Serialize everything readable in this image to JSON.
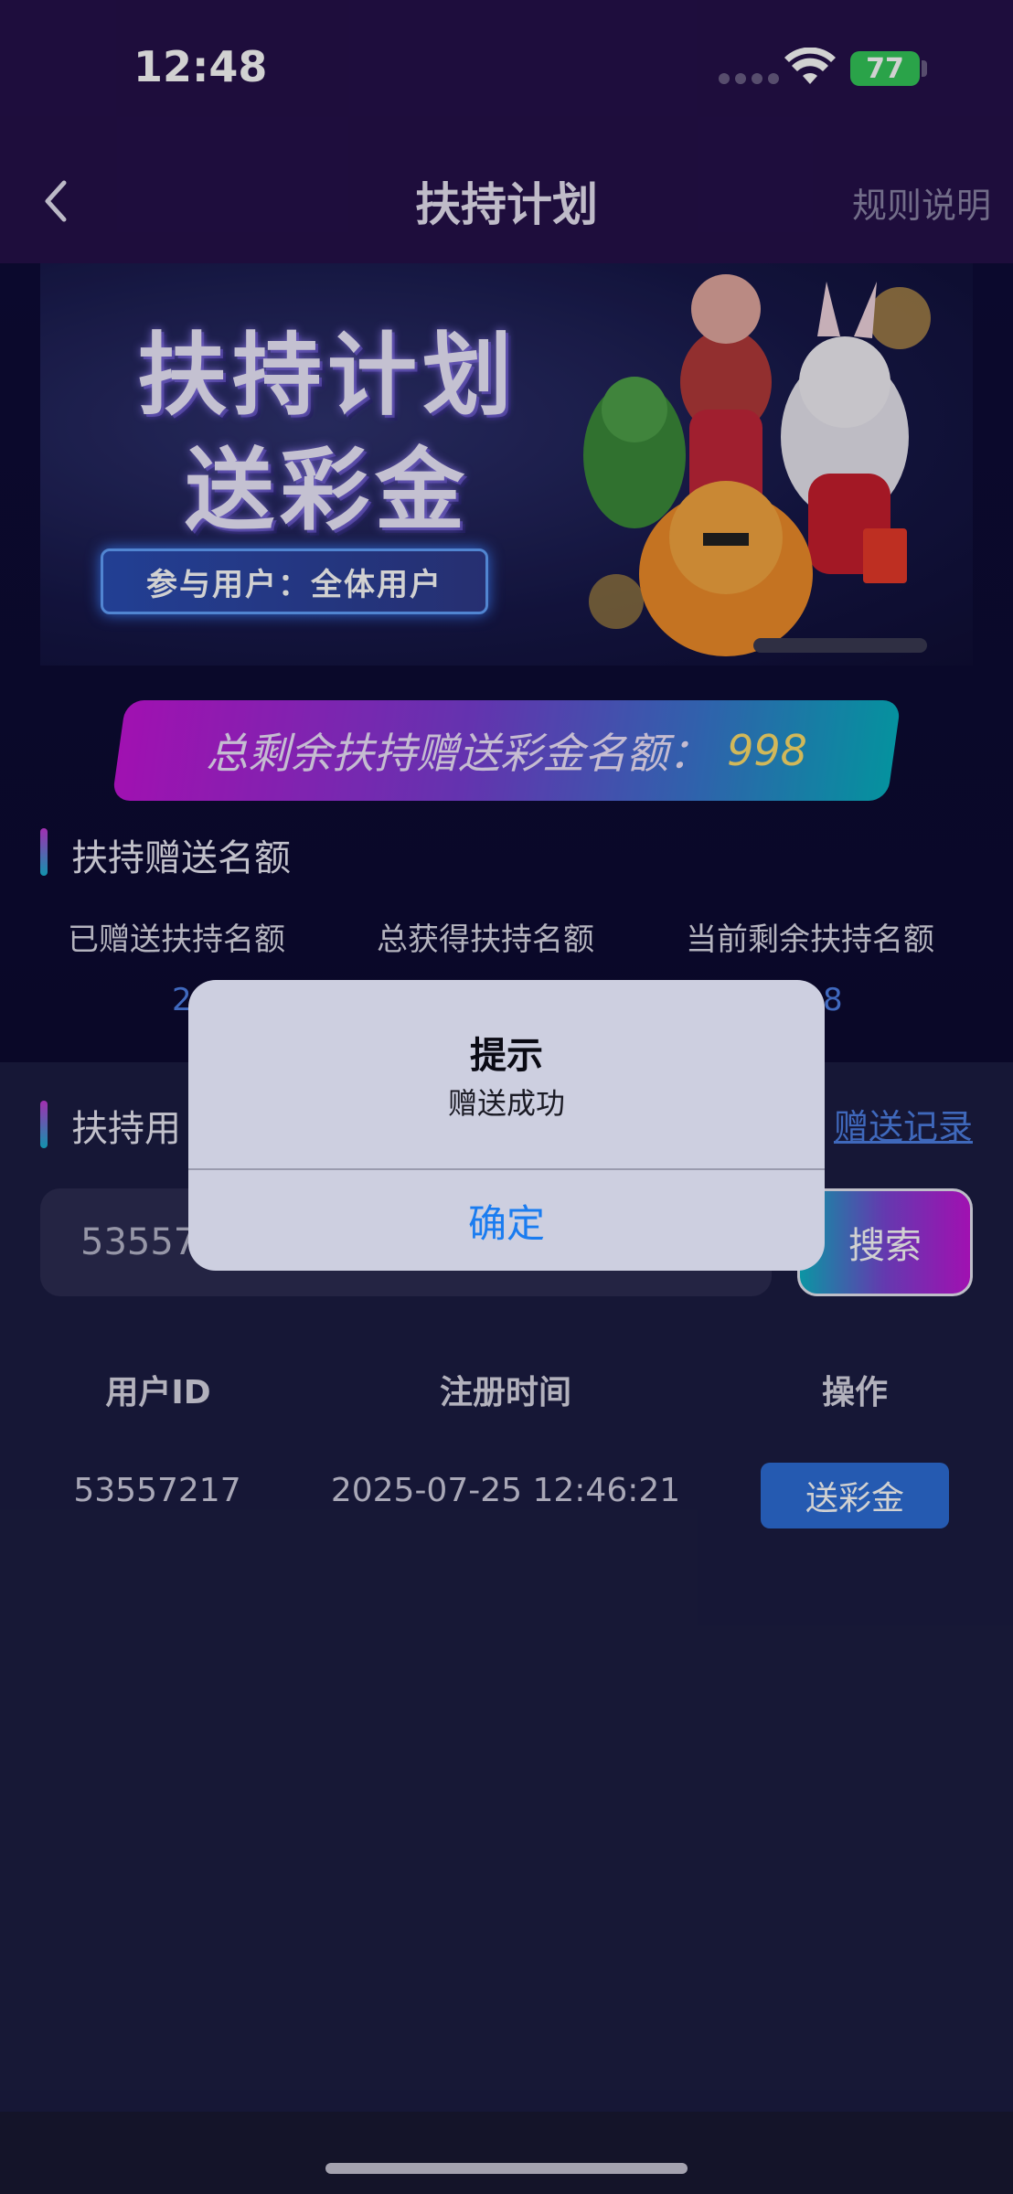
{
  "status_bar": {
    "time": "12:48",
    "battery": "77"
  },
  "nav": {
    "title": "扶持计划",
    "rules_label": "规则说明"
  },
  "banner": {
    "title_line1": "扶持计划",
    "title_line2": "送彩金",
    "tag": "参与用户：全体用户"
  },
  "quota": {
    "label": "总剩余扶持赠送彩金名额：",
    "value": "998"
  },
  "section1": {
    "title": "扶持赠送名额",
    "stats": [
      {
        "label": "已赠送扶持名额",
        "value": "2"
      },
      {
        "label": "总获得扶持名额",
        "value": ""
      },
      {
        "label": "当前剩余扶持名额",
        "value": "8"
      }
    ]
  },
  "section2": {
    "title_partial": "扶持用",
    "records_link": "赠送记录",
    "search_value": "53557",
    "search_button": "搜索"
  },
  "table": {
    "headers": [
      "用户ID",
      "注册时间",
      "操作"
    ],
    "rows": [
      {
        "user_id": "53557217",
        "reg_time": "2025-07-25 12:46:21",
        "action": "送彩金"
      }
    ]
  },
  "alert": {
    "title": "提示",
    "message": "赠送成功",
    "ok": "确定"
  }
}
